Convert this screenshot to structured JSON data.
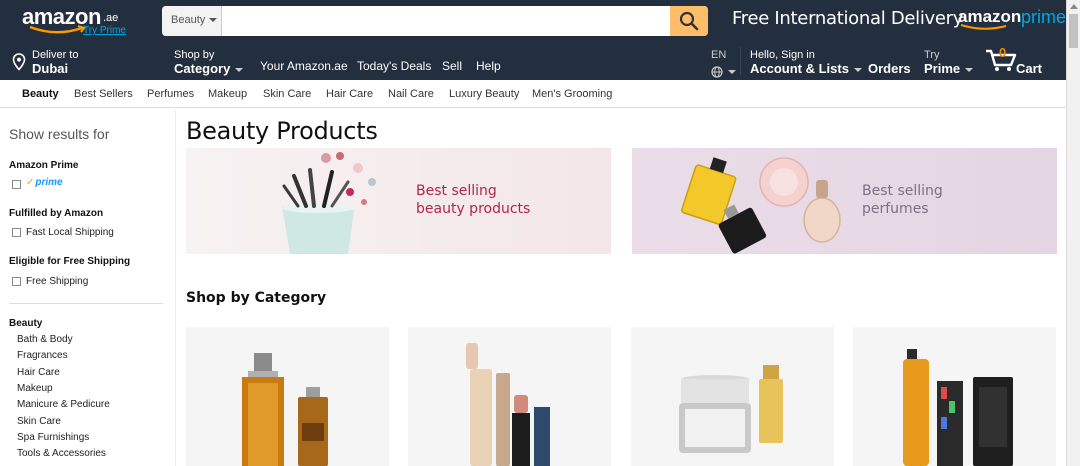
{
  "header": {
    "logo_word": "amazon",
    "logo_tld": ".ae",
    "try_prime": "Try Prime",
    "search": {
      "category": "Beauty",
      "placeholder": "",
      "value": ""
    },
    "promo_text": "Free International Delivery",
    "promo_brand_amazon": "amazon",
    "promo_brand_prime": "prime"
  },
  "nav": {
    "deliver_line1": "Deliver to",
    "deliver_line2": "Dubai",
    "shop_line1": "Shop by",
    "shop_line2": "Category",
    "links": [
      "Your Amazon.ae",
      "Today's Deals",
      "Sell",
      "Help"
    ],
    "lang": "EN",
    "account_line1": "Hello, Sign in",
    "account_line2": "Account & Lists",
    "orders": "Orders",
    "prime_line1": "Try",
    "prime_line2": "Prime",
    "cart_count": "0",
    "cart_label": "Cart"
  },
  "subnav": [
    "Beauty",
    "Best Sellers",
    "Perfumes",
    "Makeup",
    "Skin Care",
    "Hair Care",
    "Nail Care",
    "Luxury Beauty",
    "Men's Grooming"
  ],
  "sidebar": {
    "heading": "Show results for",
    "prime_heading": "Amazon Prime",
    "prime_badge": "prime",
    "fulfilled_heading": "Fulfilled by Amazon",
    "fulfilled_option": "Fast Local Shipping",
    "free_heading": "Eligible for Free Shipping",
    "free_option": "Free Shipping",
    "category_heading": "Beauty",
    "categories": [
      "Bath & Body",
      "Fragrances",
      "Hair Care",
      "Makeup",
      "Manicure & Pedicure",
      "Skin Care",
      "Spa Furnishings",
      "Tools & Accessories"
    ]
  },
  "main": {
    "title": "Beauty Products",
    "banner1_line1": "Best selling",
    "banner1_line2": "beauty products",
    "banner2_line1": "Best selling",
    "banner2_line2": "perfumes",
    "section_title": "Shop by Category"
  },
  "colors": {
    "nav_bg": "#232f3e",
    "search_button": "#febd69",
    "prime_blue": "#00a8e1",
    "cart_orange": "#f08804",
    "banner1_text": "#b2264a"
  }
}
